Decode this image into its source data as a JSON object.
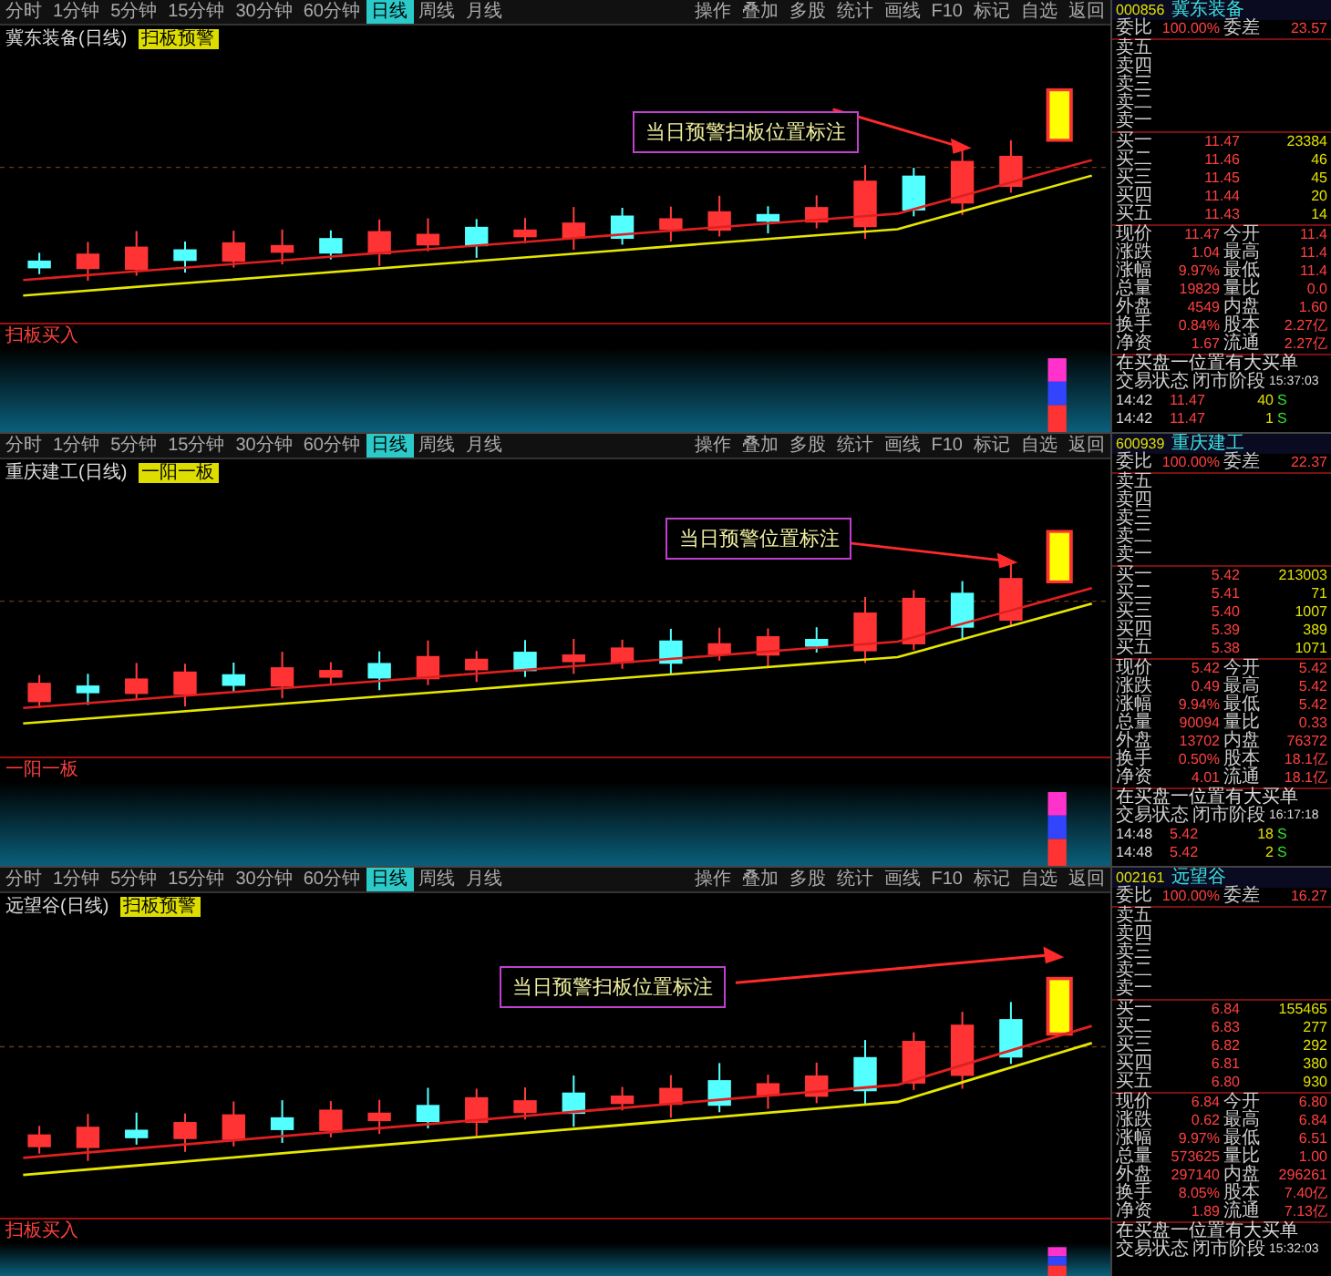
{
  "panels": [
    {
      "toolbar": {
        "periods": [
          {
            "label": "分时",
            "selected": false
          },
          {
            "label": "1分钟",
            "selected": false
          },
          {
            "label": "5分钟",
            "selected": false
          },
          {
            "label": "15分钟",
            "selected": false
          },
          {
            "label": "30分钟",
            "selected": false
          },
          {
            "label": "60分钟",
            "selected": false
          },
          {
            "label": "日线",
            "selected": true
          },
          {
            "label": "周线",
            "selected": false
          },
          {
            "label": "月线",
            "selected": false
          }
        ],
        "actions": [
          "操作",
          "叠加",
          "多股",
          "统计",
          "画线",
          "F10",
          "标记",
          "自选",
          "返回"
        ]
      },
      "title": "冀东装备(日线)",
      "tag": "扫板预警",
      "annotation": "当日预警扫板位置标注",
      "indicator_title": "扫板买入",
      "quote": {
        "code": "000856",
        "name": "冀东装备",
        "summary": {
          "l1": "委比",
          "v1": "100.00%",
          "l2": "委差",
          "v2": "23.57"
        },
        "asks": [
          "卖五",
          "卖四",
          "卖三",
          "卖二",
          "卖一"
        ],
        "bids": [
          {
            "label": "买一",
            "price": "11.47",
            "volume": "23384"
          },
          {
            "label": "买二",
            "price": "11.46",
            "volume": "46"
          },
          {
            "label": "买三",
            "price": "11.45",
            "volume": "45"
          },
          {
            "label": "买四",
            "price": "11.44",
            "volume": "20"
          },
          {
            "label": "买五",
            "price": "11.43",
            "volume": "14"
          }
        ],
        "stats": [
          {
            "l1": "现价",
            "v1": "11.47",
            "l2": "今开",
            "v2": "11.4"
          },
          {
            "l1": "涨跌",
            "v1": "1.04",
            "l2": "最高",
            "v2": "11.4"
          },
          {
            "l1": "涨幅",
            "v1": "9.97%",
            "l2": "最低",
            "v2": "11.4"
          },
          {
            "l1": "总量",
            "v1": "19829",
            "l2": "量比",
            "v2": "0.0"
          },
          {
            "l1": "外盘",
            "v1": "4549",
            "l2": "内盘",
            "v2": "1.60"
          },
          {
            "l1": "换手",
            "v1": "0.84%",
            "l2": "股本",
            "v2": "2.27亿"
          },
          {
            "l1": "净资",
            "v1": "1.67",
            "l2": "流通",
            "v2": "2.27亿"
          }
        ],
        "notice": "在买盘一位置有大买单",
        "status": {
          "label": "交易状态",
          "value": "闭市阶段",
          "time": "15:37:03"
        },
        "ticks": [
          {
            "time": "14:42",
            "price": "11.47",
            "volume": "40",
            "side": "S"
          },
          {
            "time": "14:42",
            "price": "11.47",
            "volume": "1",
            "side": "S"
          }
        ]
      }
    },
    {
      "toolbar": {
        "periods": [
          {
            "label": "分时",
            "selected": false
          },
          {
            "label": "1分钟",
            "selected": false
          },
          {
            "label": "5分钟",
            "selected": false
          },
          {
            "label": "15分钟",
            "selected": false
          },
          {
            "label": "30分钟",
            "selected": false
          },
          {
            "label": "60分钟",
            "selected": false
          },
          {
            "label": "日线",
            "selected": true
          },
          {
            "label": "周线",
            "selected": false
          },
          {
            "label": "月线",
            "selected": false
          }
        ],
        "actions": [
          "操作",
          "叠加",
          "多股",
          "统计",
          "画线",
          "F10",
          "标记",
          "自选",
          "返回"
        ]
      },
      "title": "重庆建工(日线)",
      "tag": "一阳一板",
      "annotation": "当日预警位置标注",
      "indicator_title": "一阳一板",
      "quote": {
        "code": "600939",
        "name": "重庆建工",
        "summary": {
          "l1": "委比",
          "v1": "100.00%",
          "l2": "委差",
          "v2": "22.37"
        },
        "asks": [
          "卖五",
          "卖四",
          "卖三",
          "卖二",
          "卖一"
        ],
        "bids": [
          {
            "label": "买一",
            "price": "5.42",
            "volume": "213003"
          },
          {
            "label": "买二",
            "price": "5.41",
            "volume": "71"
          },
          {
            "label": "买三",
            "price": "5.40",
            "volume": "1007"
          },
          {
            "label": "买四",
            "price": "5.39",
            "volume": "389"
          },
          {
            "label": "买五",
            "price": "5.38",
            "volume": "1071"
          }
        ],
        "stats": [
          {
            "l1": "现价",
            "v1": "5.42",
            "l2": "今开",
            "v2": "5.42"
          },
          {
            "l1": "涨跌",
            "v1": "0.49",
            "l2": "最高",
            "v2": "5.42"
          },
          {
            "l1": "涨幅",
            "v1": "9.94%",
            "l2": "最低",
            "v2": "5.42"
          },
          {
            "l1": "总量",
            "v1": "90094",
            "l2": "量比",
            "v2": "0.33"
          },
          {
            "l1": "外盘",
            "v1": "13702",
            "l2": "内盘",
            "v2": "76372"
          },
          {
            "l1": "换手",
            "v1": "0.50%",
            "l2": "股本",
            "v2": "18.1亿"
          },
          {
            "l1": "净资",
            "v1": "4.01",
            "l2": "流通",
            "v2": "18.1亿"
          }
        ],
        "notice": "在买盘一位置有大买单",
        "status": {
          "label": "交易状态",
          "value": "闭市阶段",
          "time": "16:17:18"
        },
        "ticks": [
          {
            "time": "14:48",
            "price": "5.42",
            "volume": "18",
            "side": "S"
          },
          {
            "time": "14:48",
            "price": "5.42",
            "volume": "2",
            "side": "S"
          }
        ]
      }
    },
    {
      "toolbar": {
        "periods": [
          {
            "label": "分时",
            "selected": false
          },
          {
            "label": "1分钟",
            "selected": false
          },
          {
            "label": "5分钟",
            "selected": false
          },
          {
            "label": "15分钟",
            "selected": false
          },
          {
            "label": "30分钟",
            "selected": false
          },
          {
            "label": "60分钟",
            "selected": false
          },
          {
            "label": "日线",
            "selected": true
          },
          {
            "label": "周线",
            "selected": false
          },
          {
            "label": "月线",
            "selected": false
          }
        ],
        "actions": [
          "操作",
          "叠加",
          "多股",
          "统计",
          "画线",
          "F10",
          "标记",
          "自选",
          "返回"
        ]
      },
      "title": "远望谷(日线)",
      "tag": "扫板预警",
      "annotation": "当日预警扫板位置标注",
      "indicator_title": "扫板买入",
      "quote": {
        "code": "002161",
        "name": "远望谷",
        "summary": {
          "l1": "委比",
          "v1": "100.00%",
          "l2": "委差",
          "v2": "16.27"
        },
        "asks": [
          "卖五",
          "卖四",
          "卖三",
          "卖二",
          "卖一"
        ],
        "bids": [
          {
            "label": "买一",
            "price": "6.84",
            "volume": "155465"
          },
          {
            "label": "买二",
            "price": "6.83",
            "volume": "277"
          },
          {
            "label": "买三",
            "price": "6.82",
            "volume": "292"
          },
          {
            "label": "买四",
            "price": "6.81",
            "volume": "380"
          },
          {
            "label": "买五",
            "price": "6.80",
            "volume": "930"
          }
        ],
        "stats": [
          {
            "l1": "现价",
            "v1": "6.84",
            "l2": "今开",
            "v2": "6.80"
          },
          {
            "l1": "涨跌",
            "v1": "0.62",
            "l2": "最高",
            "v2": "6.84"
          },
          {
            "l1": "涨幅",
            "v1": "9.97%",
            "l2": "最低",
            "v2": "6.51"
          },
          {
            "l1": "总量",
            "v1": "573625",
            "l2": "量比",
            "v2": "1.00"
          },
          {
            "l1": "外盘",
            "v1": "297140",
            "l2": "内盘",
            "v2": "296261"
          },
          {
            "l1": "换手",
            "v1": "8.05%",
            "l2": "股本",
            "v2": "7.40亿"
          },
          {
            "l1": "净资",
            "v1": "1.89",
            "l2": "流通",
            "v2": "7.13亿"
          }
        ],
        "notice": "在买盘一位置有大买单",
        "status": {
          "label": "交易状态",
          "value": "闭市阶段",
          "time": "15:32:03"
        }
      }
    }
  ]
}
